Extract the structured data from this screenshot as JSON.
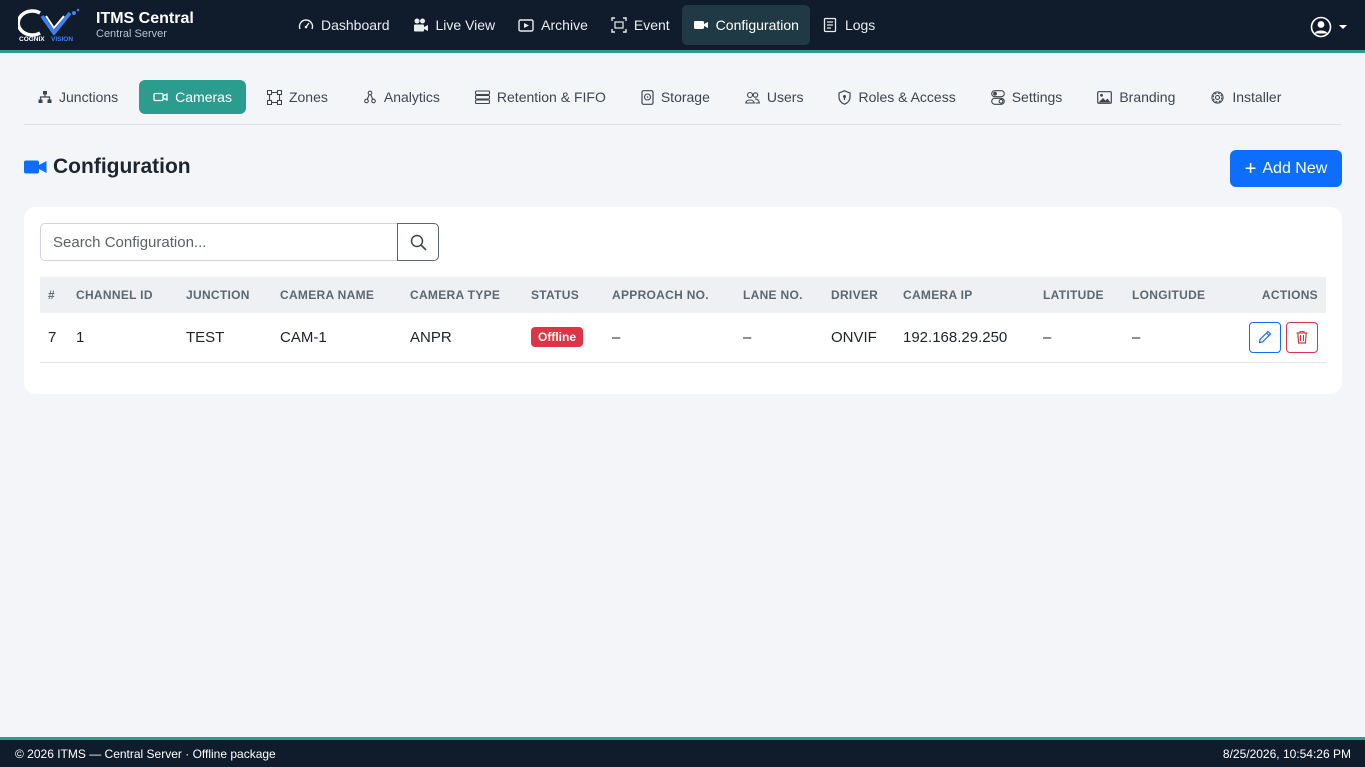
{
  "app": {
    "title": "ITMS Central",
    "subtitle": "Central Server",
    "logo_text": "COGNIX VISION"
  },
  "nav": [
    {
      "label": "Dashboard",
      "icon": "speedometer-icon"
    },
    {
      "label": "Live View",
      "icon": "camera-reels-icon"
    },
    {
      "label": "Archive",
      "icon": "play-folder-icon"
    },
    {
      "label": "Event",
      "icon": "scan-icon"
    },
    {
      "label": "Configuration",
      "icon": "video-camera-icon",
      "active": true
    },
    {
      "label": "Logs",
      "icon": "journal-icon"
    }
  ],
  "subtabs": [
    {
      "label": "Junctions",
      "icon": "hierarchy-icon"
    },
    {
      "label": "Cameras",
      "icon": "camera-icon",
      "active": true
    },
    {
      "label": "Zones",
      "icon": "bounding-box-icon"
    },
    {
      "label": "Analytics",
      "icon": "analytics-icon"
    },
    {
      "label": "Retention & FIFO",
      "icon": "hdd-stack-icon"
    },
    {
      "label": "Storage",
      "icon": "device-icon"
    },
    {
      "label": "Users",
      "icon": "people-icon"
    },
    {
      "label": "Roles & Access",
      "icon": "shield-icon"
    },
    {
      "label": "Settings",
      "icon": "toggles-icon"
    },
    {
      "label": "Branding",
      "icon": "image-icon"
    },
    {
      "label": "Installer",
      "icon": "gear-icon"
    }
  ],
  "page": {
    "title": "Configuration",
    "add_label": "Add New"
  },
  "search": {
    "placeholder": "Search Configuration..."
  },
  "table": {
    "headers": [
      "#",
      "CHANNEL ID",
      "JUNCTION",
      "CAMERA NAME",
      "CAMERA TYPE",
      "STATUS",
      "APPROACH NO.",
      "LANE NO.",
      "DRIVER",
      "CAMERA IP",
      "LATITUDE",
      "LONGITUDE",
      "ACTIONS"
    ],
    "rows": [
      {
        "num": "7",
        "channel_id": "1",
        "junction": "TEST",
        "camera_name": "CAM-1",
        "camera_type": "ANPR",
        "status": "Offline",
        "approach": "–",
        "lane": "–",
        "driver": "ONVIF",
        "ip": "192.168.29.250",
        "lat": "–",
        "lon": "–"
      }
    ]
  },
  "footer": {
    "left": "© 2026 ITMS — Central Server · Offline package",
    "right": "8/25/2026, 10:54:26 PM"
  },
  "colors": {
    "navbar": "#101b2b",
    "accent": "#2a9d8f",
    "primary": "#0d6efd",
    "danger": "#dc3545",
    "background": "#f4f5f9"
  }
}
